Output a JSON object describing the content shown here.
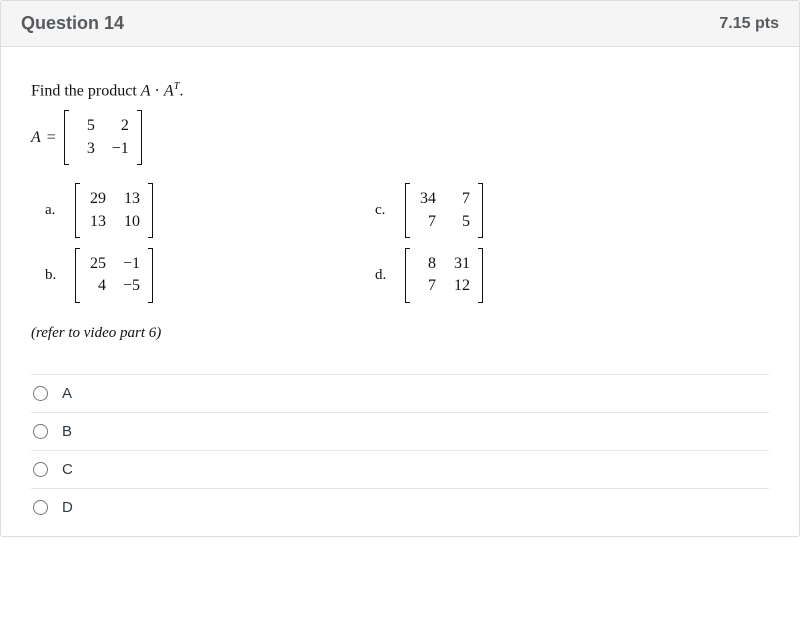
{
  "header": {
    "title": "Question 14",
    "points": "7.15 pts"
  },
  "prompt": {
    "text_prefix": "Find the product ",
    "expr_A": "A",
    "dot": " · ",
    "expr_At_base": "A",
    "expr_At_sup": "T",
    "period": "."
  },
  "matrixA": {
    "label_lhs": "A",
    "equals": " = ",
    "rows": [
      [
        "5",
        "2"
      ],
      [
        "3",
        "−1"
      ]
    ]
  },
  "choices": {
    "a": {
      "letter": "a.",
      "rows": [
        [
          "29",
          "13"
        ],
        [
          "13",
          "10"
        ]
      ]
    },
    "b": {
      "letter": "b.",
      "rows": [
        [
          "25",
          "−1"
        ],
        [
          "4",
          "−5"
        ]
      ]
    },
    "c": {
      "letter": "c.",
      "rows": [
        [
          "34",
          "7"
        ],
        [
          "7",
          "5"
        ]
      ]
    },
    "d": {
      "letter": "d.",
      "rows": [
        [
          "8",
          "31"
        ],
        [
          "7",
          "12"
        ]
      ]
    }
  },
  "note": "(refer to video part 6)",
  "answers": {
    "A": "A",
    "B": "B",
    "C": "C",
    "D": "D"
  }
}
